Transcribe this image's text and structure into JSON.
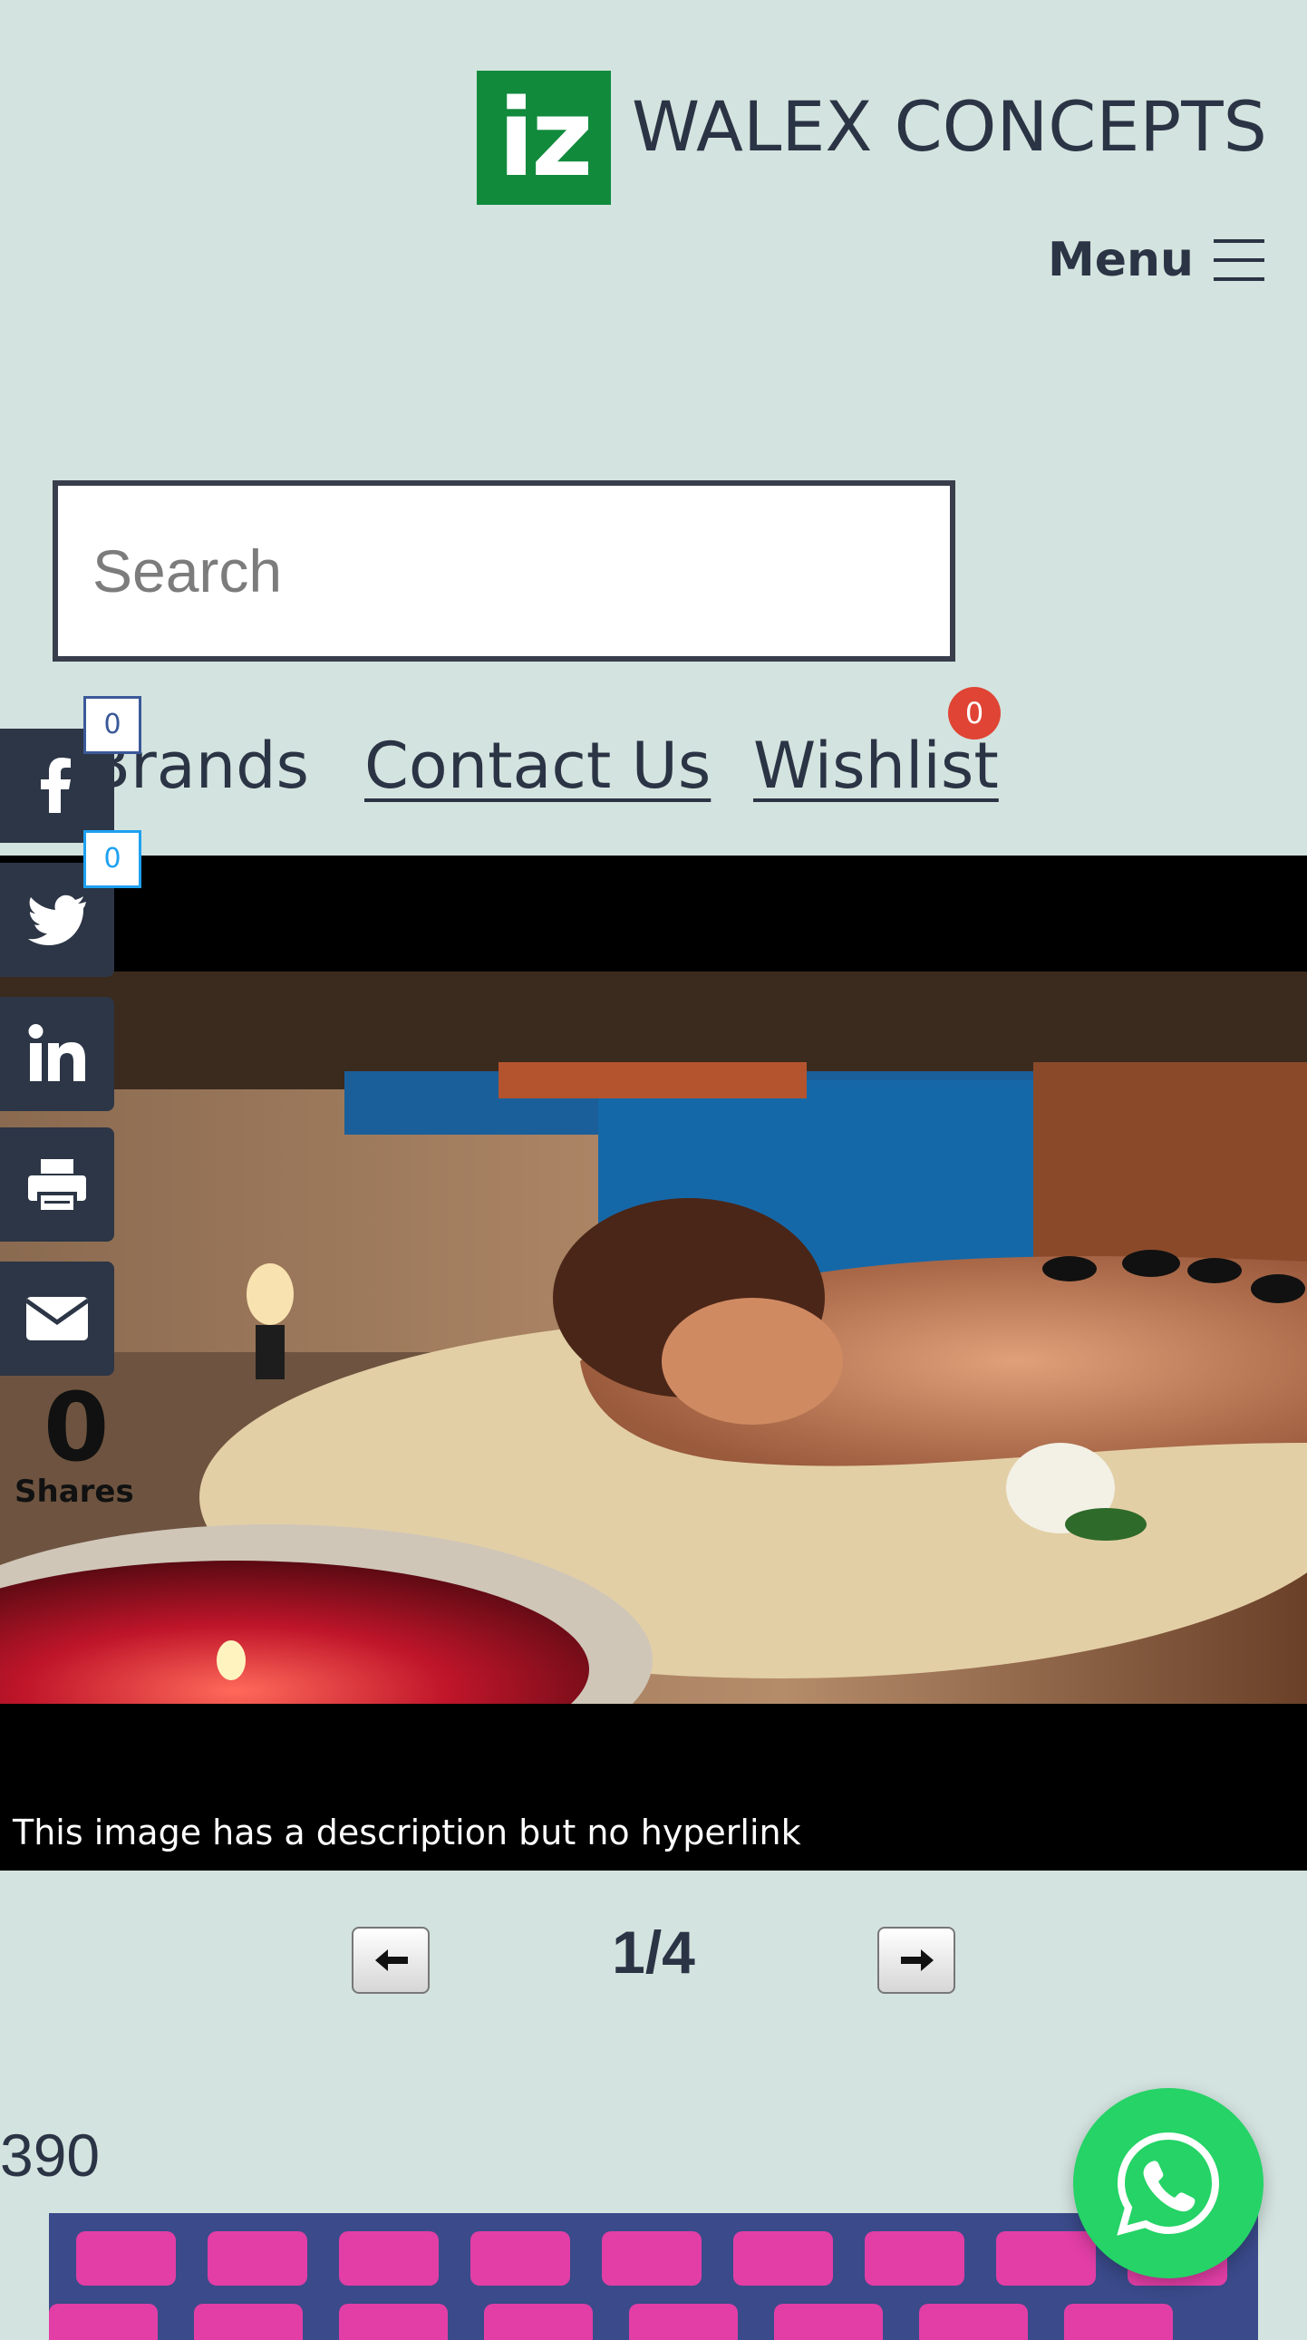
{
  "header": {
    "logo_text": "iz",
    "brand_name": "WALEX CONCEPTS",
    "menu_label": "Menu"
  },
  "search": {
    "placeholder": "Search"
  },
  "nav": {
    "links": [
      {
        "label": "Brands"
      },
      {
        "label": "Contact Us"
      },
      {
        "label": "Wishlist"
      }
    ],
    "wishlist_count": "0"
  },
  "social": {
    "facebook_count": "0",
    "twitter_count": "0",
    "shares_total": "0",
    "shares_label": "Shares",
    "buttons": [
      "facebook-icon",
      "twitter-icon",
      "linkedin-icon",
      "print-icon",
      "email-icon"
    ]
  },
  "slideshow": {
    "caption": "This image has a description but no hyperlink",
    "counter": "1/4"
  },
  "listing": {
    "count": "390"
  },
  "colors": {
    "page_bg": "#d3e3df",
    "logo_green": "#118a3c",
    "social_bg": "#2c3646",
    "badge_red": "#e04434",
    "whatsapp_green": "#25d366"
  }
}
